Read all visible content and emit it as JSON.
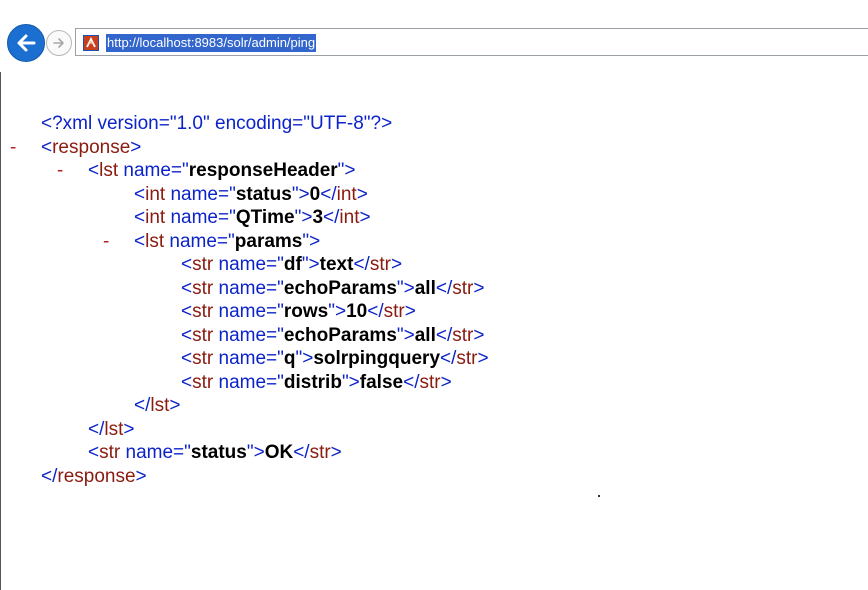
{
  "browser": {
    "url": "http://localhost:8983/solr/admin/ping",
    "icons": {
      "back": "back-arrow-icon",
      "forward": "forward-arrow-icon",
      "site": "site-favicon-icon"
    }
  },
  "xml": {
    "declaration": "<?xml version=\"1.0\" encoding=\"UTF-8\"?>",
    "collapse_marker": "-",
    "response_open": "response",
    "response_close": "response",
    "response_header": {
      "tag": "lst",
      "name_attr": "name",
      "name": "responseHeader",
      "items": [
        {
          "tag": "int",
          "name": "status",
          "value": "0"
        },
        {
          "tag": "int",
          "name": "QTime",
          "value": "3"
        }
      ],
      "params": {
        "tag": "lst",
        "name": "params",
        "items": [
          {
            "tag": "str",
            "name": "df",
            "value": "text"
          },
          {
            "tag": "str",
            "name": "echoParams",
            "value": "all"
          },
          {
            "tag": "str",
            "name": "rows",
            "value": "10"
          },
          {
            "tag": "str",
            "name": "echoParams",
            "value": "all"
          },
          {
            "tag": "str",
            "name": "q",
            "value": "solrpingquery"
          },
          {
            "tag": "str",
            "name": "distrib",
            "value": "false"
          }
        ]
      }
    },
    "status": {
      "tag": "str",
      "name": "status",
      "value": "OK"
    }
  },
  "colors": {
    "markup_blue": "#0b23c8",
    "tag_red": "#8b1a10",
    "collapse_red": "#b22222",
    "url_highlight": "#3366cc",
    "back_button": "#1a6fd0"
  }
}
